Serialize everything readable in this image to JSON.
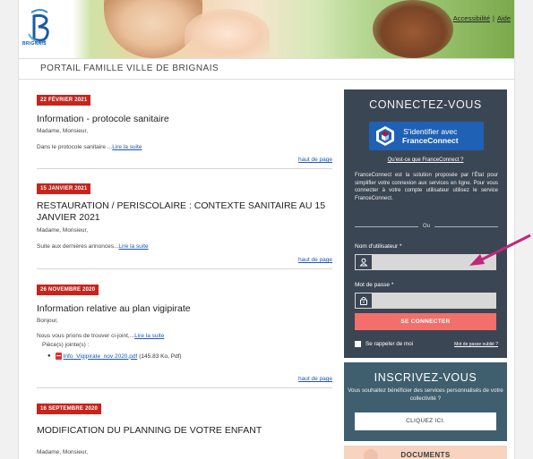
{
  "header": {
    "logo_text": "BRIGNAIS",
    "accessibility_link": "Accessibilité",
    "separator": "|",
    "help_link": "Aide",
    "portal_title": "PORTAIL FAMILLE VILLE DE BRIGNAIS"
  },
  "news": {
    "articles": [
      {
        "date": "22 FÉVRIER 2021",
        "title": "Information - protocole sanitaire",
        "greeting": "Madame, Monsieur,",
        "excerpt": "Dans le protocole sanitaire ...",
        "read_more": "Lire la suite",
        "top_link": "haut de page"
      },
      {
        "date": "15 JANVIER 2021",
        "title": "RESTAURATION / PERISCOLAIRE : CONTEXTE SANITAIRE AU 15 JANVIER 2021",
        "greeting": "Madame, Monsieur,",
        "excerpt": "Suite aux dernières annonces...",
        "read_more": "Lire la suite",
        "top_link": "haut de page"
      },
      {
        "date": "26 NOVEMBRE 2020",
        "title": "Information relative au plan vigipirate",
        "greeting": "Bonjour,",
        "excerpt": "Nous vous prions de trouver ci-joint,...",
        "read_more": "Lire la suite",
        "attachments_label": "Pièce(s) jointe(s) :",
        "attachment_name": "Info_Vigipirate_nov 2020.pdf",
        "attachment_meta": "(145.83 Ko, Pdf)",
        "top_link": "haut de page"
      },
      {
        "date": "16 SEPTEMBRE 2020",
        "title": "MODIFICATION DU PLANNING DE VOTRE ENFANT",
        "greeting": "Madame, Monsieur,"
      }
    ]
  },
  "login": {
    "title": "CONNECTEZ-VOUS",
    "franceconnect_line1": "S'identifier avec",
    "franceconnect_line2": "FranceConnect",
    "franceconnect_what": "Qu'est-ce que FranceConnect ?",
    "franceconnect_desc": "FranceConnect est la solution proposée par l'État pour simplifier votre connexion aux services en ligne. Pour vous connecter à votre compte utilisateur utilisez le service FranceConnect.",
    "or_label": "Ou",
    "username_label": "Nom d'utilisateur *",
    "username_value": "",
    "password_label": "Mot de passe *",
    "password_value": "",
    "submit_label": "SE CONNECTER",
    "remember_label": "Se rappeler de moi",
    "forgot_label": "Mot de passe oublié ?"
  },
  "register": {
    "title": "INSCRIVEZ-VOUS",
    "description": "Vous souhaitez bénéficier des services personnalisés de votre collectivité ?",
    "button_label": "CLIQUEZ ICI."
  },
  "documents": {
    "title": "DOCUMENTS"
  },
  "colors": {
    "date_badge": "#c8241c",
    "link": "#1f55b8",
    "login_panel": "#3b4654",
    "login_button": "#f26f6b",
    "franceconnect": "#1f61b4",
    "register_panel": "#3f5f6e",
    "documents_panel": "#f7d3c0",
    "annotation_arrow": "#c2267a"
  }
}
